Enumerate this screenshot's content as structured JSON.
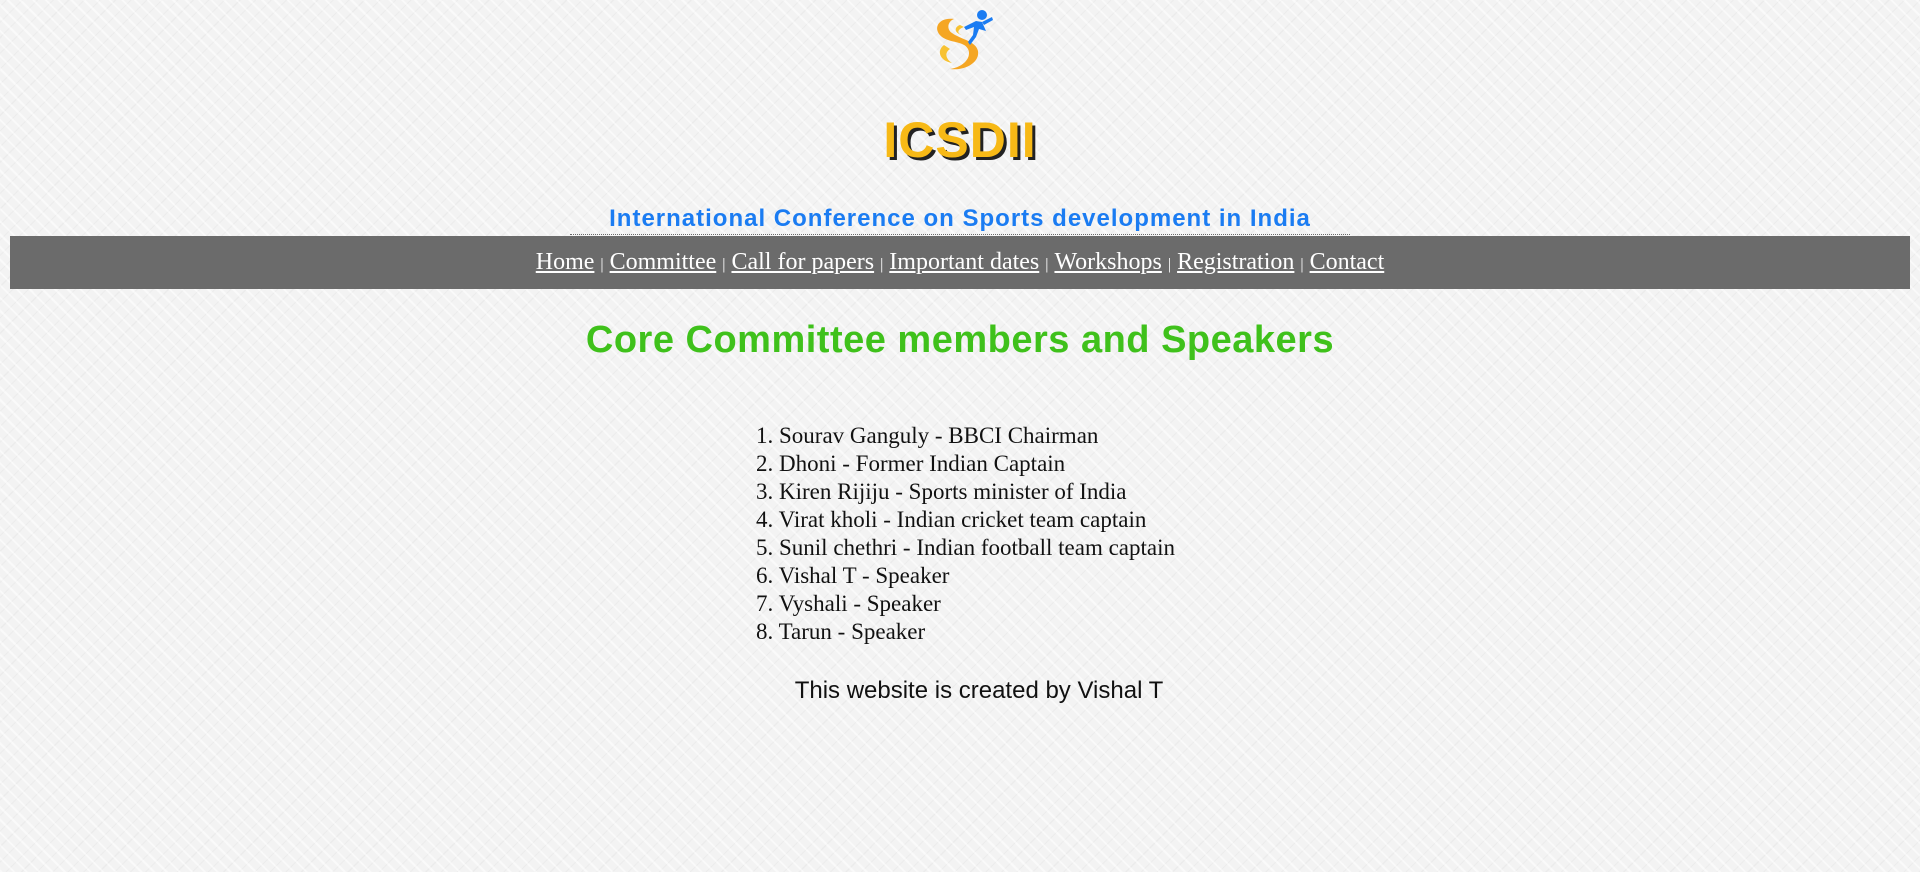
{
  "header": {
    "title": "ICSDII",
    "subtitle": "International Conference on Sports development in India"
  },
  "nav": {
    "items": [
      {
        "label": "Home"
      },
      {
        "label": "Committee"
      },
      {
        "label": "Call for papers"
      },
      {
        "label": "Important dates"
      },
      {
        "label": "Workshops"
      },
      {
        "label": "Registration"
      },
      {
        "label": "Contact"
      }
    ],
    "separator": "|"
  },
  "main": {
    "heading": "Core Committee members and Speakers",
    "members": [
      {
        "num": "1.",
        "text": "Sourav Ganguly - BBCI Chairman"
      },
      {
        "num": "2.",
        "text": "Dhoni - Former Indian Captain"
      },
      {
        "num": "3.",
        "text": "Kiren Rijiju - Sports minister of India"
      },
      {
        "num": "4.",
        "text": "Virat kholi - Indian cricket team captain"
      },
      {
        "num": "5.",
        "text": "Sunil chethri - Indian football team captain"
      },
      {
        "num": "6.",
        "text": "Vishal T - Speaker"
      },
      {
        "num": "7.",
        "text": "Vyshali - Speaker"
      },
      {
        "num": "8.",
        "text": "Tarun - Speaker"
      }
    ]
  },
  "footer": {
    "text": "This website is created by Vishal T"
  },
  "colors": {
    "title": "#f7b916",
    "subtitle": "#1b7cf2",
    "nav_bg": "#6b6b6b",
    "heading": "#3fc11b",
    "logo_orange": "#f5a623",
    "logo_blue": "#1b7cf2"
  },
  "icons": {
    "logo": "sports-runner-logo-icon"
  }
}
